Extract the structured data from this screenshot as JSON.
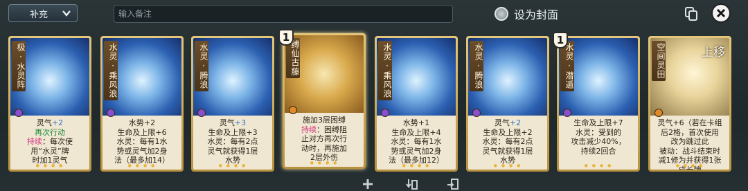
{
  "topbar": {
    "category": "补充",
    "note_placeholder": "输入备注",
    "cover_label": "设为封面"
  },
  "colors": {
    "accent": "#e4c77a",
    "blue_text": "#2b6fc0",
    "pink_text": "#d0347e"
  },
  "cards": [
    {
      "name": "极·水灵阵",
      "element": "water",
      "cost": "",
      "lines": [
        [
          "灵气",
          "+2",
          "blue"
        ],
        [
          "再次行动",
          "",
          "green"
        ],
        [
          "持续",
          "：每次使",
          "pink"
        ],
        [
          "用“水灵”牌",
          "",
          ""
        ],
        [
          "时加1灵气",
          "",
          ""
        ]
      ]
    },
    {
      "name": "水灵·乘风浪",
      "element": "water",
      "cost": "",
      "lines": [
        [
          "水势+2",
          "",
          ""
        ],
        [
          "生命及上限+6",
          "",
          ""
        ],
        [
          "水灵：每有1水",
          "",
          ""
        ],
        [
          "势或灵气加2身",
          "",
          ""
        ],
        [
          "法（最多加14）",
          "",
          ""
        ]
      ]
    },
    {
      "name": "水灵·腾浪",
      "element": "water",
      "cost": "",
      "lines": [
        [
          "灵气",
          "+3",
          "blue"
        ],
        [
          "生命及上限+3",
          "",
          ""
        ],
        [
          "水灵：每有2点",
          "",
          ""
        ],
        [
          "灵气就获得1层",
          "",
          ""
        ],
        [
          "水势",
          "",
          ""
        ]
      ]
    },
    {
      "name": "缚仙古藤",
      "element": "wood",
      "cost": "1",
      "lines": [
        [
          "施加3层困缚",
          "",
          ""
        ],
        [
          "持续",
          "：困缚阻",
          "pink"
        ],
        [
          "止对方再次行",
          "",
          ""
        ],
        [
          "动时，再施加",
          "",
          ""
        ],
        [
          "2层外伤",
          "",
          ""
        ]
      ]
    },
    {
      "name": "水灵·乘风浪",
      "element": "water",
      "cost": "",
      "lines": [
        [
          "水势+1",
          "",
          ""
        ],
        [
          "生命及上限+4",
          "",
          ""
        ],
        [
          "水灵：每有1水",
          "",
          ""
        ],
        [
          "势或灵气加2身",
          "",
          ""
        ],
        [
          "法（最多加12）",
          "",
          ""
        ]
      ]
    },
    {
      "name": "水灵·腾浪",
      "element": "water",
      "cost": "",
      "lines": [
        [
          "灵气",
          "+2",
          "blue"
        ],
        [
          "生命及上限+2",
          "",
          ""
        ],
        [
          "水灵：每有2点",
          "",
          ""
        ],
        [
          "灵气就获得1层",
          "",
          ""
        ],
        [
          "水势",
          "",
          ""
        ]
      ]
    },
    {
      "name": "水灵·潜遁",
      "element": "water",
      "cost": "1",
      "lines": [
        [
          "",
          "",
          ""
        ],
        [
          "生命及上限+7",
          "",
          ""
        ],
        [
          "水灵：受到的",
          "",
          ""
        ],
        [
          "攻击减少40%，",
          "",
          ""
        ],
        [
          "持续2回合",
          "",
          ""
        ]
      ]
    },
    {
      "name": "空间灵田",
      "element": "earth",
      "cost": "",
      "lines": [
        [
          "灵气+6（若在卡组",
          "",
          ""
        ],
        [
          "后2格，首次使用",
          "",
          ""
        ],
        [
          "改为跳过此",
          "",
          ""
        ],
        [
          "被动：战斗结束时",
          "",
          ""
        ],
        [
          "减1修为并获得1张",
          "",
          ""
        ],
        [
          "成长牌",
          "",
          ""
        ]
      ]
    }
  ],
  "card8_overlay": "上移"
}
